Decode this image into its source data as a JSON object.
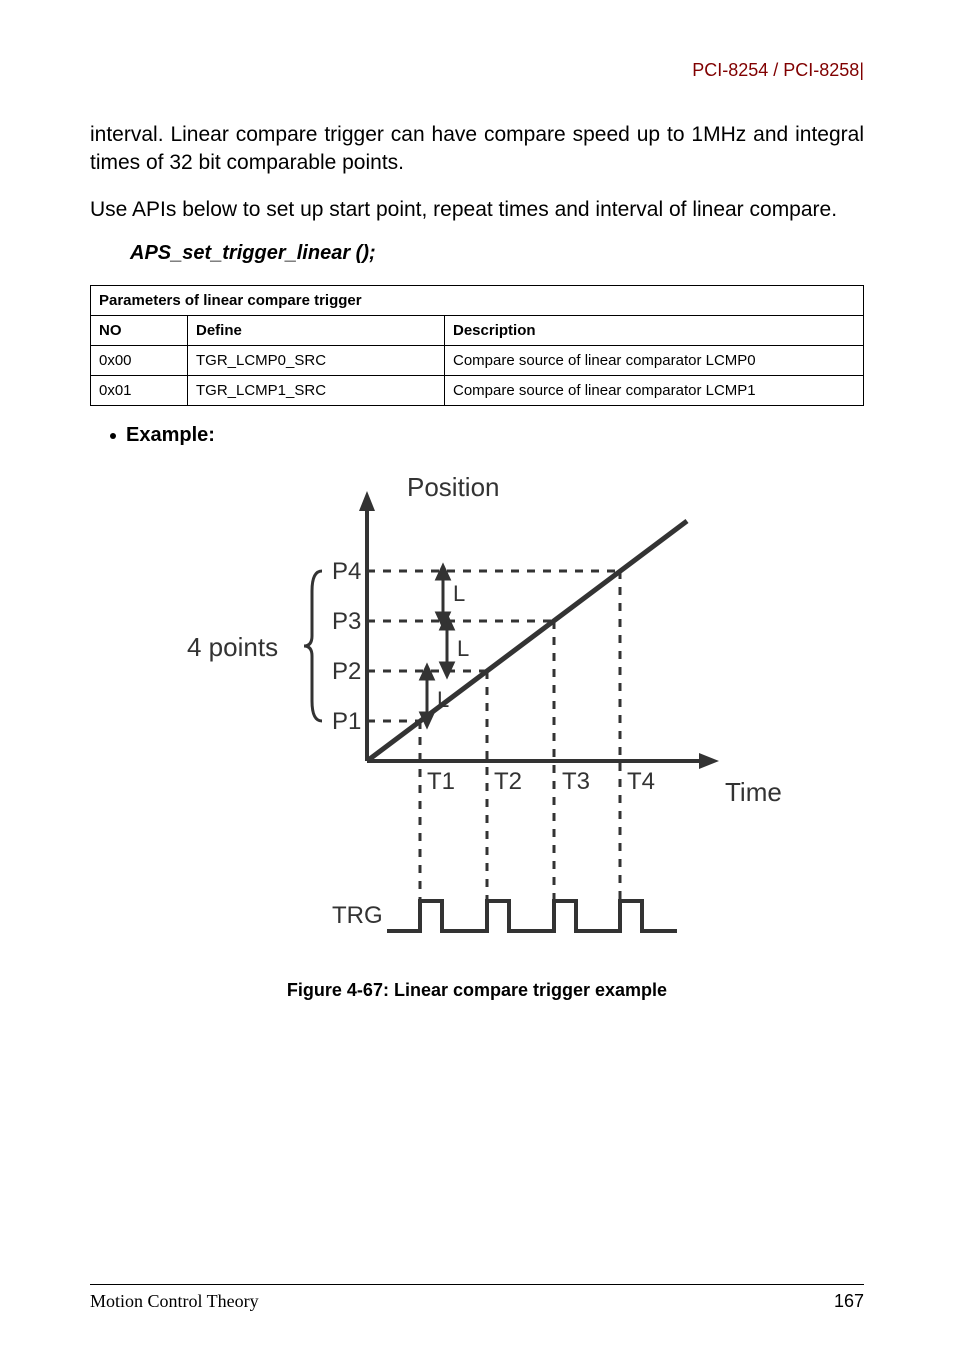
{
  "header": {
    "product": "PCI-8254 / PCI-8258"
  },
  "paragraphs": {
    "p1": "interval. Linear compare trigger can have compare speed up to 1MHz and integral times of 32 bit comparable points.",
    "p2": "Use APIs below to set up start point, repeat times and interval of linear compare."
  },
  "api": "APS_set_trigger_linear ();",
  "table": {
    "title": "Parameters of linear compare trigger",
    "headers": {
      "no": "NO",
      "define": "Define",
      "desc": "Description"
    },
    "rows": [
      {
        "no": "0x00",
        "define": "TGR_LCMP0_SRC",
        "desc": "Compare source of linear comparator LCMP0"
      },
      {
        "no": "0x01",
        "define": "TGR_LCMP1_SRC",
        "desc": "Compare source of linear comparator LCMP1"
      }
    ]
  },
  "example_label": "Example:",
  "chart_data": {
    "type": "diagram",
    "title": "Linear compare trigger example",
    "y_axis_label": "Position",
    "x_axis_label": "Time",
    "group_label": "4 points",
    "positions": [
      "P1",
      "P2",
      "P3",
      "P4"
    ],
    "interval_label": "L",
    "time_ticks": [
      "T1",
      "T2",
      "T3",
      "T4"
    ],
    "trigger_label": "TRG"
  },
  "figure_caption": "Figure 4-67: Linear compare trigger example",
  "footer": {
    "section": "Motion Control Theory",
    "page": "167"
  }
}
